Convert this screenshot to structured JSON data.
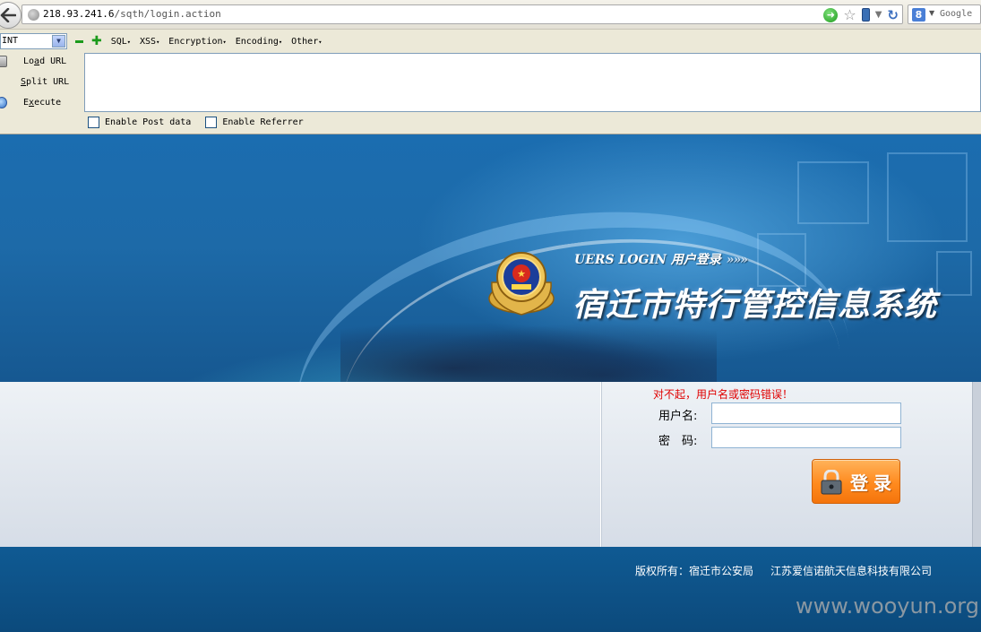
{
  "browser": {
    "url_host": "218.93.241.6",
    "url_path": "/sqth/login.action",
    "search_placeholder": "Google",
    "icons": [
      "back-arrow-icon",
      "globe-icon",
      "go-icon",
      "star-icon",
      "phone-icon",
      "dropdown-icon",
      "reload-icon",
      "google-icon"
    ]
  },
  "hackbar": {
    "select_value": "INT",
    "menu": [
      "SQL",
      "XSS",
      "Encryption",
      "Encoding",
      "Other"
    ],
    "actions": [
      {
        "label_pre": "Lo",
        "label_u": "a",
        "label_post": "d URL",
        "icon": "load-url-icon"
      },
      {
        "label_pre": "",
        "label_u": "S",
        "label_post": "plit URL",
        "icon": "split-url-icon"
      },
      {
        "label_pre": "E",
        "label_u": "x",
        "label_post": "ecute",
        "icon": "execute-icon"
      }
    ],
    "textarea_value": "",
    "checks": {
      "post": "Enable Post data",
      "referrer": "Enable Referrer"
    }
  },
  "banner": {
    "login_tag": "UERS LOGIN 用户登录",
    "login_arrows": "»»»",
    "system_title": "宿迁市特行管控信息系统",
    "emblem": "police-emblem-icon"
  },
  "login": {
    "error": "对不起，用户名或密码错误！",
    "username_label": "用户名:",
    "password_label": "密　码:",
    "username_value": "",
    "password_value": "",
    "button_label": "登录",
    "accent": "#ff8a1e",
    "error_color": "#e00000"
  },
  "footer": {
    "copyright": "版权所有：宿迁市公安局",
    "company": "江苏爱信诺航天信息科技有限公司",
    "watermark": "www.wooyun.org"
  }
}
